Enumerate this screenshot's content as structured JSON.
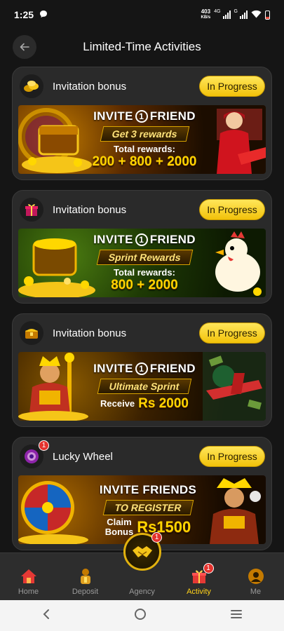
{
  "status_bar": {
    "time": "1:25",
    "net_speed_value": "403",
    "net_speed_unit": "KB/s",
    "net_type_1": "4G",
    "net_type_2": "G"
  },
  "header": {
    "title": "Limited-Time Activities"
  },
  "activities": [
    {
      "title": "Invitation bonus",
      "status": "In Progress",
      "banner": {
        "headline_a": "INVITE",
        "headline_num": "1",
        "headline_b": "FRIEND",
        "pill": "Get 3 rewards",
        "sub": "Total rewards:",
        "amount": "200 + 800 + 2000"
      }
    },
    {
      "title": "Invitation bonus",
      "status": "In Progress",
      "banner": {
        "headline_a": "INVITE",
        "headline_num": "1",
        "headline_b": "FRIEND",
        "pill": "Sprint Rewards",
        "sub": "Total rewards:",
        "amount": "800 + 2000"
      }
    },
    {
      "title": "Invitation bonus",
      "status": "In Progress",
      "banner": {
        "headline_a": "INVITE",
        "headline_num": "1",
        "headline_b": "FRIEND",
        "pill": "Ultimate Sprint",
        "sub": "Receive",
        "amount": "Rs 2000"
      }
    },
    {
      "title": "Lucky Wheel",
      "status": "In Progress",
      "badge": "1",
      "banner": {
        "headline": "INVITE FRIENDS",
        "pill": "TO REGISTER",
        "sub_line1": "Claim",
        "sub_line2": "Bonus",
        "amount": "Rs1500"
      }
    }
  ],
  "bottom_nav": {
    "items": [
      {
        "label": "Home",
        "icon": "home-icon"
      },
      {
        "label": "Deposit",
        "icon": "deposit-icon"
      },
      {
        "label": "Agency",
        "icon": "handshake-icon",
        "badge": "1"
      },
      {
        "label": "Activity",
        "icon": "gift-icon",
        "badge": "1",
        "active": true
      },
      {
        "label": "Me",
        "icon": "profile-icon"
      }
    ]
  },
  "colors": {
    "accent": "#ffd21a",
    "background": "#151515",
    "card": "#2a2a2a",
    "badge": "#e5322d"
  }
}
